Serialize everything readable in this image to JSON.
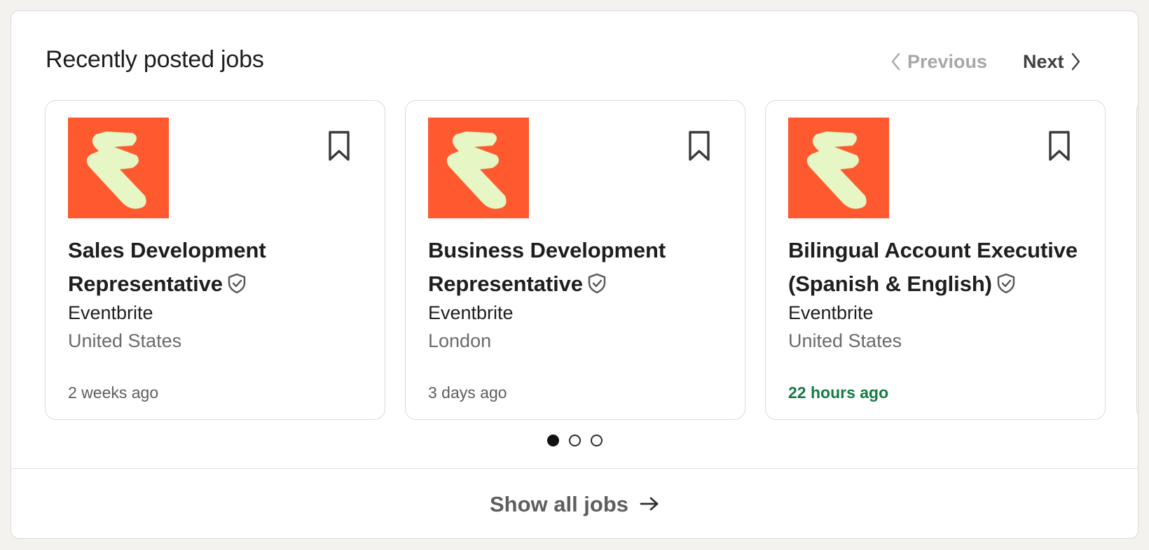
{
  "section": {
    "title": "Recently posted jobs",
    "previous_label": "Previous",
    "next_label": "Next"
  },
  "colors": {
    "logo_bg": "#ff5a2f",
    "logo_mark": "#e6f6c4",
    "fresh_posted": "#157a44"
  },
  "jobs": [
    {
      "title": "Sales Development Representative",
      "verified": true,
      "company": "Eventbrite",
      "location": "United States",
      "posted": "2 weeks ago",
      "logo_icon": "eventbrite-logo"
    },
    {
      "title": "Business Development Representative",
      "verified": true,
      "company": "Eventbrite",
      "location": "London",
      "posted": "3 days ago",
      "logo_icon": "eventbrite-logo"
    },
    {
      "title": "Bilingual Account Executive (Spanish & English)",
      "verified": true,
      "company": "Eventbrite",
      "location": "United States",
      "posted": "22 hours ago",
      "logo_icon": "eventbrite-logo"
    }
  ],
  "pagination": {
    "pages": 3,
    "current": 1
  },
  "footer": {
    "show_all_label": "Show all jobs"
  }
}
